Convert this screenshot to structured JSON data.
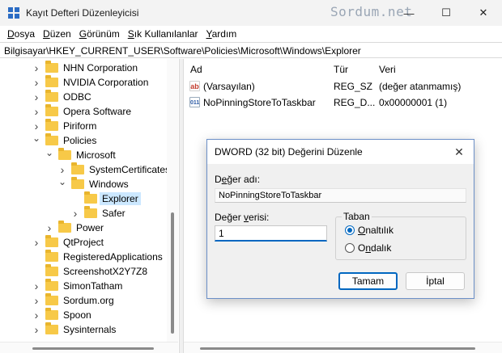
{
  "window": {
    "title": "Kayıt Defteri Düzenleyicisi",
    "watermark": "Sordum.net",
    "controls": {
      "minimize": "—",
      "maximize": "☐",
      "close": "✕"
    }
  },
  "menu": [
    {
      "pre": "",
      "u": "D",
      "post": "osya"
    },
    {
      "pre": "",
      "u": "D",
      "post": "üzen"
    },
    {
      "pre": "",
      "u": "G",
      "post": "örünüm"
    },
    {
      "pre": "",
      "u": "S",
      "post": "ık Kullanılanlar"
    },
    {
      "pre": "",
      "u": "Y",
      "post": "ardım"
    }
  ],
  "address": "Bilgisayar\\HKEY_CURRENT_USER\\Software\\Policies\\Microsoft\\Windows\\Explorer",
  "tree": [
    {
      "label": "NHN Corporation",
      "level": 0,
      "chevron": "right"
    },
    {
      "label": "NVIDIA Corporation",
      "level": 0,
      "chevron": "right"
    },
    {
      "label": "ODBC",
      "level": 0,
      "chevron": "right"
    },
    {
      "label": "Opera Software",
      "level": 0,
      "chevron": "right"
    },
    {
      "label": "Piriform",
      "level": 0,
      "chevron": "right"
    },
    {
      "label": "Policies",
      "level": 0,
      "chevron": "down"
    },
    {
      "label": "Microsoft",
      "level": 1,
      "chevron": "down"
    },
    {
      "label": "SystemCertificates",
      "level": 2,
      "chevron": "right"
    },
    {
      "label": "Windows",
      "level": 2,
      "chevron": "down"
    },
    {
      "label": "Explorer",
      "level": 3,
      "chevron": "none",
      "selected": true
    },
    {
      "label": "Safer",
      "level": 3,
      "chevron": "right"
    },
    {
      "label": "Power",
      "level": 1,
      "chevron": "right"
    },
    {
      "label": "QtProject",
      "level": 0,
      "chevron": "right"
    },
    {
      "label": "RegisteredApplications",
      "level": 0,
      "chevron": "none"
    },
    {
      "label": "ScreenshotX2Y7Z8",
      "level": 0,
      "chevron": "none"
    },
    {
      "label": "SimonTatham",
      "level": 0,
      "chevron": "right"
    },
    {
      "label": "Sordum.org",
      "level": 0,
      "chevron": "right"
    },
    {
      "label": "Spoon",
      "level": 0,
      "chevron": "right"
    },
    {
      "label": "Sysinternals",
      "level": 0,
      "chevron": "right"
    }
  ],
  "list": {
    "headers": {
      "name": "Ad",
      "type": "Tür",
      "data": "Veri"
    },
    "rows": [
      {
        "icon": "string-value-icon",
        "icon_text": "ab",
        "name": "(Varsayılan)",
        "type": "REG_SZ",
        "data": "(değer atanmamış)"
      },
      {
        "icon": "binary-value-icon",
        "icon_text": "011",
        "name": "NoPinningStoreToTaskbar",
        "type": "REG_D...",
        "data": "0x00000001 (1)"
      }
    ]
  },
  "dialog": {
    "title": "DWORD (32 bit) Değerini Düzenle",
    "close": "✕",
    "name_label_pre": "D",
    "name_label_u": "e",
    "name_label_post": "ğer adı:",
    "name_value": "NoPinningStoreToTaskbar",
    "data_label_pre": "Değer ",
    "data_label_u": "v",
    "data_label_post": "erisi:",
    "data_value": "1",
    "base_label": "Taban",
    "base_hex_pre": "",
    "base_hex_u": "O",
    "base_hex_post": "naltılık",
    "base_dec_pre": "O",
    "base_dec_u": "n",
    "base_dec_post": "dalık",
    "base_selected": "hex",
    "ok": "Tamam",
    "cancel": "İptal"
  }
}
